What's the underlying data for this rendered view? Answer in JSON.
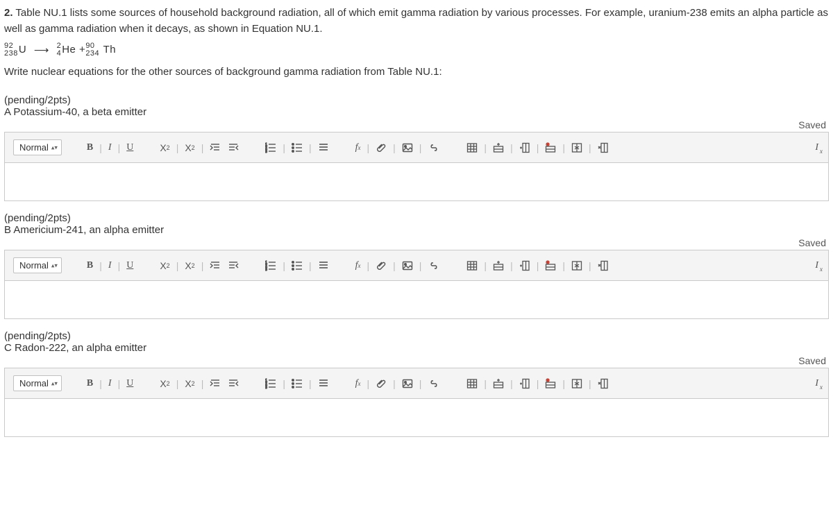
{
  "intro": {
    "number": "2.",
    "text": "Table NU.1 lists some sources of household background radiation, all of which emit gamma radiation by various processes. For example, uranium-238 emits an alpha particle as well as gamma radiation when it decays, as shown in Equation NU.1."
  },
  "equation": {
    "u_top": "92",
    "u_bot": "238",
    "u_sym": "U",
    "arrow": "⟶",
    "he_top": "2",
    "he_bot": "4",
    "he_sym": "He",
    "plus": "+",
    "th_top": "90",
    "th_bot": "234",
    "th_sym": "Th"
  },
  "prompt": "Write nuclear equations for the other sources of background gamma radiation from Table NU.1:",
  "saved_label": "Saved",
  "toolbar": {
    "style_select": "Normal",
    "bold": "B",
    "italic": "I",
    "underline": "U",
    "sub": "X",
    "sub_mark": "2",
    "sup": "X",
    "sup_mark": "2",
    "fx": "f",
    "fx_sub": "x",
    "pipe": "|",
    "clear_fmt": "x"
  },
  "parts": [
    {
      "pending": "(pending/2pts)",
      "title": "A Potassium-40, a beta emitter"
    },
    {
      "pending": "(pending/2pts)",
      "title": "B Americium-241, an alpha emitter"
    },
    {
      "pending": "(pending/2pts)",
      "title": "C Radon-222, an alpha emitter"
    }
  ]
}
